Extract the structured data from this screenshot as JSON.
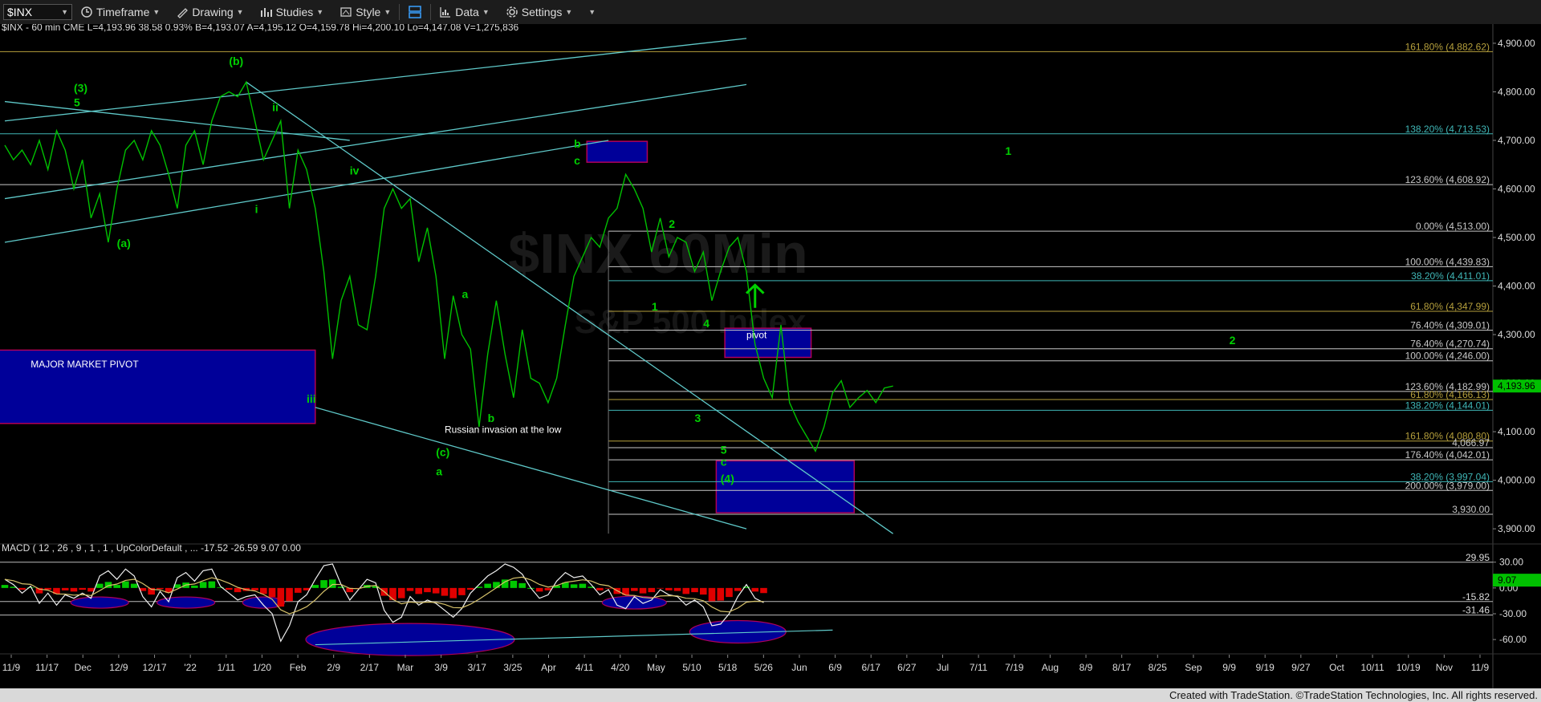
{
  "toolbar": {
    "symbol": "$INX",
    "items": [
      "Timeframe",
      "Drawing",
      "Studies",
      "Style",
      "Data",
      "Settings"
    ]
  },
  "colors": {
    "price": "#00c000",
    "fib_white": "#c8c8c8",
    "fib_teal": "#3fb6b6",
    "fib_gold": "#b6a03c",
    "trendline": "#5fc9c9",
    "box_fill": "#000099",
    "box_border": "#b0005a",
    "wave_green": "#00d000",
    "price_tag": "#00c000",
    "macd_line": "#c8c8a0",
    "hist_up": "#00c800",
    "hist_down": "#e00000"
  },
  "chart_data": [
    {
      "type": "line",
      "header": "$INX - 60 min  CME  L=4,193.96  38.58  0.93%  B=4,193.07  A=4,195.12  O=4,159.78  Hi=4,200.10  Lo=4,147.08  V=1,275,836",
      "watermark": "$INX 60Min",
      "watermark_sub": "S&P 500 Index",
      "x_ticks": [
        "11/9",
        "11/17",
        "Dec",
        "12/9",
        "12/17",
        "'22",
        "1/11",
        "1/20",
        "Feb",
        "2/9",
        "2/17",
        "Mar",
        "3/9",
        "3/17",
        "3/25",
        "Apr",
        "4/11",
        "4/20",
        "May",
        "5/10",
        "5/18",
        "5/26",
        "Jun",
        "6/9",
        "6/17",
        "6/27",
        "Jul",
        "7/11",
        "7/19",
        "Aug",
        "8/9",
        "8/17",
        "8/25",
        "Sep",
        "9/9",
        "9/19",
        "9/27",
        "Oct",
        "10/11",
        "10/19",
        "Nov",
        "11/9"
      ],
      "y_ticks": [
        3900,
        4000,
        4100,
        4200,
        4300,
        4400,
        4500,
        4600,
        4700,
        4800,
        4900
      ],
      "y_tick_labels": [
        "3,900.00",
        "4,000.00",
        "4,100.00",
        "4,200.00",
        "4,300.00",
        "4,400.00",
        "4,500.00",
        "4,600.00",
        "4,700.00",
        "4,800.00",
        "4,900.00"
      ],
      "ylim": [
        3882,
        4923
      ],
      "last_price": 4193.96,
      "last_price_label": "4,193.96",
      "series": [
        {
          "x": [
            0,
            1,
            2,
            3,
            4,
            5,
            6,
            7,
            8,
            9,
            10,
            11,
            12,
            13,
            14,
            15,
            16,
            17,
            18,
            19,
            20,
            21,
            22,
            23,
            24,
            25,
            26,
            27,
            28,
            29,
            30,
            31,
            32,
            33,
            34,
            35,
            36,
            37,
            38,
            39,
            40,
            41,
            42,
            43,
            44,
            45,
            46,
            47,
            48,
            49,
            50,
            51,
            52,
            53,
            54,
            55,
            56,
            57,
            58,
            59,
            60,
            61,
            62,
            63,
            64,
            65,
            66,
            67,
            68,
            69,
            70,
            71,
            72,
            73,
            74,
            75,
            76,
            77,
            78,
            79,
            80,
            81,
            82,
            83,
            84,
            85,
            86,
            87,
            88,
            89,
            90,
            91,
            92,
            93,
            94,
            95,
            96,
            97,
            98,
            99,
            100,
            101,
            102,
            103,
            104,
            105,
            106,
            107,
            108,
            109,
            110
          ],
          "values": [
            4690,
            4660,
            4680,
            4650,
            4700,
            4640,
            4720,
            4680,
            4600,
            4660,
            4540,
            4590,
            4490,
            4600,
            4680,
            4700,
            4660,
            4720,
            4690,
            4630,
            4560,
            4690,
            4720,
            4650,
            4740,
            4790,
            4800,
            4790,
            4820,
            4740,
            4660,
            4700,
            4740,
            4560,
            4680,
            4640,
            4560,
            4430,
            4250,
            4370,
            4420,
            4320,
            4310,
            4420,
            4560,
            4600,
            4560,
            4580,
            4450,
            4520,
            4420,
            4250,
            4380,
            4300,
            4270,
            4110,
            4260,
            4370,
            4260,
            4170,
            4310,
            4210,
            4200,
            4160,
            4210,
            4320,
            4420,
            4460,
            4500,
            4480,
            4540,
            4560,
            4630,
            4600,
            4560,
            4470,
            4540,
            4460,
            4500,
            4490,
            4430,
            4470,
            4370,
            4430,
            4480,
            4500,
            4430,
            4280,
            4210,
            4170,
            4320,
            4160,
            4120,
            4090,
            4060,
            4110,
            4180,
            4205,
            4150,
            4170,
            4185,
            4160,
            4190,
            4194,
            null,
            null,
            null,
            null,
            null,
            null,
            null
          ],
          "name": ""
        }
      ],
      "fib_levels": [
        {
          "label": "161.80% (4,882.62)",
          "value": 4882.62,
          "color": "gold"
        },
        {
          "label": "138.20% (4,713.53)",
          "value": 4713.53,
          "color": "teal"
        },
        {
          "label": "123.60% (4,608.92)",
          "value": 4608.92,
          "color": "white"
        },
        {
          "label": "0.00% (4,513.00)",
          "value": 4513.0,
          "color": "white"
        },
        {
          "label": "100.00% (4,439.83)",
          "value": 4439.83,
          "color": "white"
        },
        {
          "label": "38.20% (4,411.01)",
          "value": 4411.01,
          "color": "teal"
        },
        {
          "label": "61.80% (4,347.99)",
          "value": 4347.99,
          "color": "gold"
        },
        {
          "label": "76.40% (4,309.01)",
          "value": 4309.01,
          "color": "white"
        },
        {
          "label": "76.40% (4,270.74)",
          "value": 4270.74,
          "color": "white"
        },
        {
          "label": "100.00% (4,246.00)",
          "value": 4246.0,
          "color": "white"
        },
        {
          "label": "123.60% (4,182.99)",
          "value": 4182.99,
          "color": "white"
        },
        {
          "label": "61.80% (4,166.13)",
          "value": 4166.13,
          "color": "gold"
        },
        {
          "label": "138.20% (4,144.01)",
          "value": 4144.01,
          "color": "teal"
        },
        {
          "label": "161.80% (4,080.80)",
          "value": 4080.8,
          "color": "gold"
        },
        {
          "label": "4,066.97",
          "value": 4066.97,
          "color": "white"
        },
        {
          "label": "176.40% (4,042.01)",
          "value": 4042.01,
          "color": "white"
        },
        {
          "label": "38.20% (3,997.04)",
          "value": 3997.04,
          "color": "teal"
        },
        {
          "label": "200.00% (3,979.00)",
          "value": 3979.0,
          "color": "white"
        },
        {
          "label": "3,930.00",
          "value": 3930.0,
          "color": "white"
        }
      ],
      "annotations": [
        {
          "text": "(3)",
          "color": "green",
          "x": 8,
          "y": 4800
        },
        {
          "text": "5",
          "color": "green",
          "x": 8,
          "y": 4770
        },
        {
          "text": "(b)",
          "color": "green",
          "x": 26,
          "y": 4855
        },
        {
          "text": "ii",
          "color": "green",
          "x": 31,
          "y": 4760
        },
        {
          "text": "iv",
          "color": "green",
          "x": 40,
          "y": 4630
        },
        {
          "text": "(a)",
          "color": "green",
          "x": 13,
          "y": 4480
        },
        {
          "text": "i",
          "color": "green",
          "x": 29,
          "y": 4550
        },
        {
          "text": "iii",
          "color": "green",
          "x": 35,
          "y": 4160
        },
        {
          "text": "(c)",
          "color": "green",
          "x": 50,
          "y": 4050
        },
        {
          "text": "a",
          "color": "green",
          "x": 50,
          "y": 4010
        },
        {
          "text": "b",
          "color": "green",
          "x": 56,
          "y": 4120
        },
        {
          "text": "a",
          "color": "green",
          "x": 53,
          "y": 4375
        },
        {
          "text": "b",
          "color": "green",
          "x": 66,
          "y": 4685
        },
        {
          "text": "c",
          "color": "green",
          "x": 66,
          "y": 4650
        },
        {
          "text": "1",
          "color": "green",
          "x": 75,
          "y": 4350
        },
        {
          "text": "2",
          "color": "green",
          "x": 77,
          "y": 4520
        },
        {
          "text": "3",
          "color": "green",
          "x": 80,
          "y": 4120
        },
        {
          "text": "4",
          "color": "green",
          "x": 81,
          "y": 4315
        },
        {
          "text": "5",
          "color": "green",
          "x": 83,
          "y": 4055
        },
        {
          "text": "c",
          "color": "green",
          "x": 83,
          "y": 4030
        },
        {
          "text": "(4)",
          "color": "green",
          "x": 83,
          "y": 3995
        },
        {
          "text": "1",
          "color": "green",
          "x": 116,
          "y": 4670
        },
        {
          "text": "2",
          "color": "green",
          "x": 142,
          "y": 4280
        },
        {
          "text": "MAJOR MARKET PIVOT",
          "color": "white",
          "x": 3,
          "y": 4232
        },
        {
          "text": "Russian invasion at the low",
          "color": "white",
          "x": 51,
          "y": 4098
        },
        {
          "text": "pivot",
          "color": "white",
          "x": 86,
          "y": 4293
        }
      ]
    },
    {
      "type": "line",
      "header": "MACD ( 12 , 26 , 9 , 1 , 1 , UpColorDefault , ... -17.52  -26.59  9.07  0.00",
      "y_ticks": [
        30,
        0,
        -30,
        -60
      ],
      "y_tick_labels": [
        "30.00",
        "0.00",
        "-30.00",
        "-60.00"
      ],
      "ylim": [
        -72,
        40
      ],
      "level_labels": [
        {
          "label": "29.95",
          "value": 29.95
        },
        {
          "label": "-15.82",
          "value": -15.82
        },
        {
          "label": "-31.46",
          "value": -31.46
        }
      ],
      "last_value_label": "9.07",
      "macd": [
        10,
        4,
        -6,
        2,
        -18,
        -6,
        -20,
        -8,
        -12,
        -6,
        -12,
        14,
        20,
        10,
        22,
        14,
        -10,
        -22,
        -4,
        -16,
        12,
        18,
        8,
        20,
        22,
        2,
        -6,
        -14,
        -10,
        -8,
        -20,
        -30,
        -62,
        -44,
        -16,
        -8,
        10,
        26,
        28,
        4,
        -14,
        -2,
        10,
        6,
        -26,
        -40,
        -34,
        -10,
        -20,
        -14,
        -18,
        -26,
        -34,
        -24,
        -6,
        4,
        14,
        20,
        28,
        24,
        16,
        0,
        -12,
        -8,
        8,
        18,
        12,
        14,
        4,
        -8,
        -2,
        -20,
        -24,
        -10,
        -18,
        -14,
        -2,
        -8,
        -10,
        -20,
        -14,
        -22,
        -44,
        -42,
        -30,
        -10,
        4,
        -12,
        -17
      ]
    }
  ],
  "footer_text": "Created with TradeStation. ©TradeStation Technologies, Inc. All rights reserved."
}
